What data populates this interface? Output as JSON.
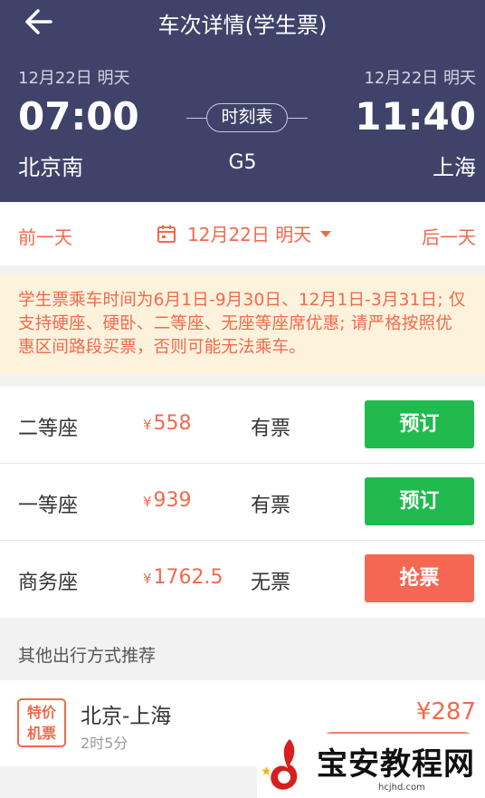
{
  "header": {
    "title": "车次详情(学生票)",
    "depart_date": "12月22日 明天",
    "arrive_date": "12月22日 明天",
    "depart_time": "07:00",
    "arrive_time": "11:40",
    "depart_station": "北京南",
    "arrive_station": "上海",
    "timetable_label": "时刻表",
    "train_no": "G5"
  },
  "datebar": {
    "prev": "前一天",
    "current": "12月22日 明天",
    "next": "后一天"
  },
  "notice": "学生票乘车时间为6月1日-9月30日、12月1日-3月31日; 仅支持硬座、硬卧、二等座、无座等座席优惠; 请严格按照优惠区间路段买票，否则可能无法乘车。",
  "seats": [
    {
      "name": "二等座",
      "yen": "¥",
      "price": "558",
      "status": "有票",
      "action": "预订"
    },
    {
      "name": "一等座",
      "yen": "¥",
      "price": "939",
      "status": "有票",
      "action": "预订"
    },
    {
      "name": "商务座",
      "yen": "¥",
      "price": "1762.5",
      "status": "无票",
      "action": "抢票"
    }
  ],
  "section_title": "其他出行方式推荐",
  "recommend": {
    "badge_line1": "特价",
    "badge_line2": "机票",
    "route": "北京-上海",
    "duration": "2时5分",
    "price": "¥287"
  },
  "watermark": {
    "text": "宝安教程网",
    "url": "hcjhd.com"
  },
  "colors": {
    "header_bg": "#3f4369",
    "accent": "#f06a4e",
    "book_green": "#20ba4e",
    "grab_red": "#f56752",
    "notice_bg": "#fdf2dc"
  },
  "icons": {
    "back": "arrow-left-icon",
    "calendar": "calendar-icon",
    "dropdown": "caret-down-icon"
  }
}
